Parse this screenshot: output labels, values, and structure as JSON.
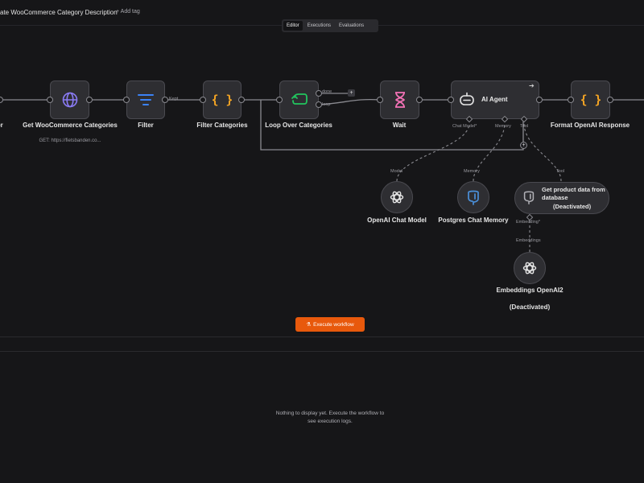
{
  "header": {
    "workflow_title": "ate WooCommerce Category Description",
    "add_tag": "+ Add tag"
  },
  "tabs": [
    "Editor",
    "Executions",
    "Evaluations"
  ],
  "nodes": {
    "trigger_partial": "er",
    "get_categories": {
      "label": "Get WooCommerce Categories",
      "subtitle": "GET: https://fietsbanden.co..."
    },
    "filter": {
      "label": "Filter",
      "branch_label": "Kept"
    },
    "filter_categories": {
      "label": "Filter Categories"
    },
    "loop": {
      "label": "Loop Over Categories",
      "out_done": "done",
      "out_loop": "loop"
    },
    "wait": {
      "label": "Wait"
    },
    "ai_agent": {
      "label": "AI Agent",
      "inputs": [
        "Chat Model*",
        "Memory",
        "Tool"
      ]
    },
    "format_response": {
      "label": "Format OpenAI Response"
    },
    "chat_model": {
      "label": "OpenAI Chat Model",
      "conn_label": "Model"
    },
    "chat_memory": {
      "label": "Postgres Chat Memory",
      "conn_label": "Memory"
    },
    "vector_tool": {
      "label": "Get product data from database",
      "status": "(Deactivated)",
      "conn_label": "Tool",
      "embedding_input": "Embedding*"
    },
    "embeddings": {
      "label": "Embeddings OpenAI2",
      "status": "(Deactivated)",
      "conn_label": "Embeddings"
    }
  },
  "execute_button": "Execute workflow",
  "logs": {
    "empty_message": "Nothing to display yet. Execute the workflow to see execution logs."
  },
  "colors": {
    "background": "#161618",
    "node_fill": "#2e2e32",
    "accent_orange": "#e8590c",
    "globe_purple": "#8b7cf6",
    "filter_blue": "#3b82f6",
    "code_orange": "#f5a524",
    "loop_green": "#22c55e",
    "wait_pink": "#f472b6",
    "postgres_blue": "#4a8fd9"
  }
}
